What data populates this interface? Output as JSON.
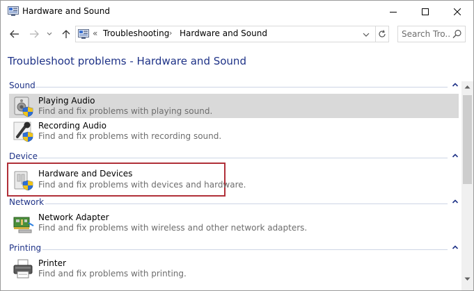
{
  "window": {
    "title": "Hardware and Sound",
    "buttons": {
      "minimize": "minimize-icon",
      "maximize": "maximize-icon",
      "close": "close-icon"
    }
  },
  "nav": {
    "back_icon": "arrow-left-icon",
    "forward_icon": "arrow-right-icon",
    "recent_icon": "chevron-down-icon",
    "up_icon": "arrow-up-icon",
    "address": {
      "overflow": "«",
      "crumbs": [
        "Troubleshooting",
        "Hardware and Sound"
      ],
      "separator": "›"
    },
    "search_placeholder": "Search Tro..."
  },
  "page": {
    "title": "Troubleshoot problems - Hardware and Sound",
    "groups": [
      {
        "label": "Sound",
        "items": [
          {
            "title": "Playing Audio",
            "desc": "Find and fix problems with playing sound.",
            "icon": "speaker-shield-icon",
            "highlighted": true
          },
          {
            "title": "Recording Audio",
            "desc": "Find and fix problems with recording sound.",
            "icon": "microphone-shield-icon"
          }
        ]
      },
      {
        "label": "Device",
        "items": [
          {
            "title": "Hardware and Devices",
            "desc": "Find and fix problems with devices and hardware.",
            "icon": "device-shield-icon",
            "boxed": true
          }
        ]
      },
      {
        "label": "Network",
        "items": [
          {
            "title": "Network Adapter",
            "desc": "Find and fix problems with wireless and other network adapters.",
            "icon": "network-adapter-icon"
          }
        ]
      },
      {
        "label": "Printing",
        "items": [
          {
            "title": "Printer",
            "desc": "Find and fix problems with printing.",
            "icon": "printer-icon"
          }
        ]
      }
    ]
  },
  "colors": {
    "heading": "#1e3287",
    "highlight": "#d9d9d9",
    "box_border": "#b02f38",
    "desc_text": "#6d6d6d"
  }
}
